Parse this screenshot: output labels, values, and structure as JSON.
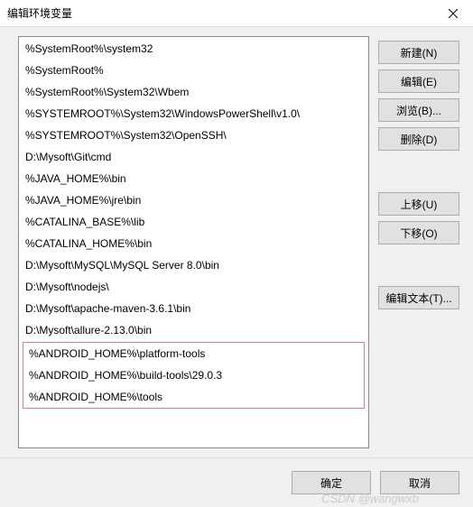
{
  "titlebar": {
    "title": "编辑环境变量"
  },
  "paths": [
    "%SystemRoot%\\system32",
    "%SystemRoot%",
    "%SystemRoot%\\System32\\Wbem",
    "%SYSTEMROOT%\\System32\\WindowsPowerShell\\v1.0\\",
    "%SYSTEMROOT%\\System32\\OpenSSH\\",
    "D:\\Mysoft\\Git\\cmd",
    "%JAVA_HOME%\\bin",
    "%JAVA_HOME%\\jre\\bin",
    "%CATALINA_BASE%\\lib",
    "%CATALINA_HOME%\\bin",
    "D:\\Mysoft\\MySQL\\MySQL Server 8.0\\bin",
    "D:\\Mysoft\\nodejs\\",
    "D:\\Mysoft\\apache-maven-3.6.1\\bin",
    "D:\\Mysoft\\allure-2.13.0\\bin"
  ],
  "highlighted_paths": [
    "%ANDROID_HOME%\\platform-tools",
    "%ANDROID_HOME%\\build-tools\\29.0.3",
    "%ANDROID_HOME%\\tools"
  ],
  "buttons": {
    "new": "新建(N)",
    "edit": "编辑(E)",
    "browse": "浏览(B)...",
    "delete": "删除(D)",
    "up": "上移(U)",
    "down": "下移(O)",
    "edit_text": "编辑文本(T)..."
  },
  "footer": {
    "ok": "确定",
    "cancel": "取消"
  },
  "watermark": "CSDN @wangwxb"
}
